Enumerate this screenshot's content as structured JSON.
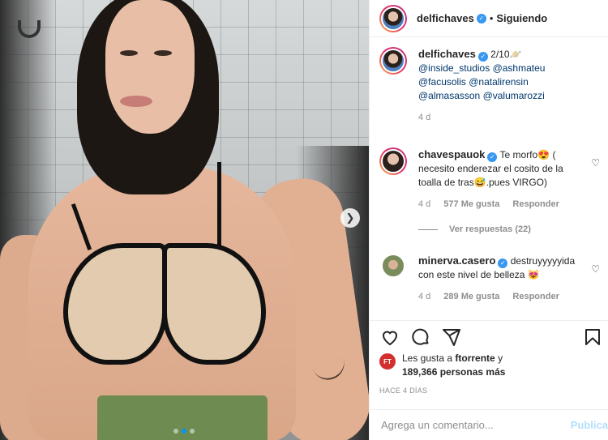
{
  "post": {
    "author": "delfichaves",
    "follow_status": "Siguiendo",
    "separator": "•",
    "caption": {
      "author": "delfichaves",
      "text": "2/10🪐",
      "mentions": [
        "@inside_studios",
        "@ashmateu",
        "@facusolis",
        "@natalirensin",
        "@almasasson",
        "@valumarozzi"
      ],
      "time": "4 d"
    },
    "carousel": {
      "total_dots": 3,
      "active_dot": 1,
      "next_icon": "chevron-right-icon"
    }
  },
  "comments": [
    {
      "author": "chavespauok",
      "text": "Te morfo😍 ( necesito enderezar el cosito de la toalla de tras😅.pues VIRGO)",
      "time": "4 d",
      "likes": "577 Me gusta",
      "reply": "Responder",
      "view_replies": "Ver respuestas (22)"
    },
    {
      "author": "minerva.casero",
      "text": "destruyyyyyida con este nivel de belleza 😻",
      "time": "4 d",
      "likes": "289 Me gusta",
      "reply": "Responder"
    }
  ],
  "likes_line": {
    "prefix": "Les gusta a",
    "user": "ftorrente",
    "conj": "y",
    "others": "189,366 personas más",
    "badge": "FT"
  },
  "date": "HACE 4 DÍAS",
  "comment_input": {
    "placeholder": "Agrega un comentario...",
    "value": ""
  },
  "publish_label": "Publicar",
  "colors": {
    "accent": "#0095f6",
    "link": "#00376b",
    "muted": "#8e8e8e",
    "verified": "#3897f0"
  }
}
